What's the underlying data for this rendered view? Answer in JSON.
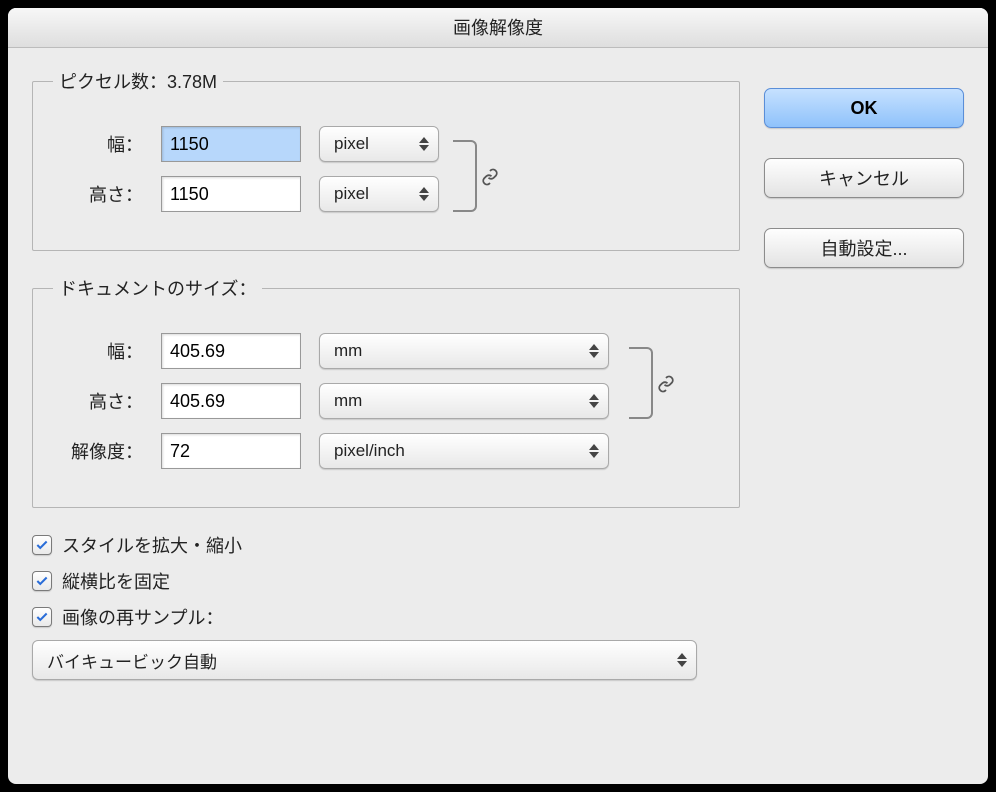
{
  "titlebar": {
    "title": "画像解像度"
  },
  "pixel_section": {
    "legend_prefix": "ピクセル数：",
    "size_text": "3.78M",
    "width_label": "幅：",
    "width_value": "1150",
    "width_unit": "pixel",
    "height_label": "高さ：",
    "height_value": "1150",
    "height_unit": "pixel"
  },
  "document_section": {
    "legend": "ドキュメントのサイズ：",
    "width_label": "幅：",
    "width_value": "405.69",
    "width_unit": "mm",
    "height_label": "高さ：",
    "height_value": "405.69",
    "height_unit": "mm",
    "resolution_label": "解像度：",
    "resolution_value": "72",
    "resolution_unit": "pixel/inch"
  },
  "checkboxes": {
    "scale_styles": {
      "checked": true,
      "label": "スタイルを拡大・縮小"
    },
    "constrain": {
      "checked": true,
      "label": "縦横比を固定"
    },
    "resample": {
      "checked": true,
      "label": "画像の再サンプル："
    }
  },
  "resample_method": "バイキュービック自動",
  "buttons": {
    "ok": "OK",
    "cancel": "キャンセル",
    "auto": "自動設定..."
  }
}
